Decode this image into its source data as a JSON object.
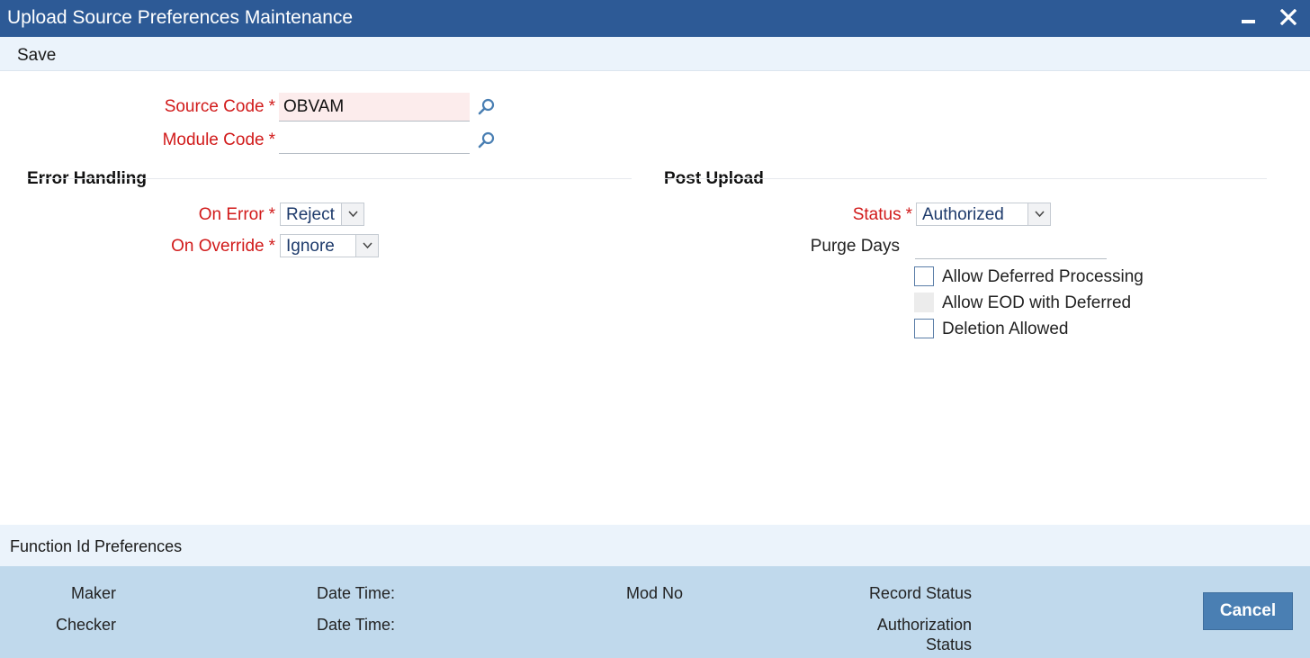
{
  "window": {
    "title": "Upload Source Preferences Maintenance",
    "minimize_icon": "minimize-icon",
    "close_icon": "close-icon"
  },
  "toolbar": {
    "save_label": "Save"
  },
  "fields": {
    "source_code": {
      "label": "Source Code",
      "required_mark": "*",
      "value": "OBVAM"
    },
    "module_code": {
      "label": "Module Code",
      "required_mark": "*",
      "value": ""
    }
  },
  "error_handling": {
    "title": "Error Handling",
    "on_error": {
      "label": "On Error",
      "required_mark": "*",
      "value": "Reject"
    },
    "on_override": {
      "label": "On Override",
      "required_mark": "*",
      "value": "Ignore"
    }
  },
  "post_upload": {
    "title": "Post Upload",
    "status": {
      "label": "Status",
      "required_mark": "*",
      "value": "Authorized"
    },
    "purge_days": {
      "label": "Purge Days",
      "value": ""
    },
    "checkboxes": [
      {
        "label": "Allow Deferred Processing",
        "checked": false,
        "enabled": true
      },
      {
        "label": "Allow EOD with Deferred",
        "checked": false,
        "enabled": false
      },
      {
        "label": "Deletion Allowed",
        "checked": false,
        "enabled": true
      }
    ]
  },
  "subsection": {
    "link_label": "Function Id Preferences"
  },
  "footer": {
    "maker_label": "Maker",
    "checker_label": "Checker",
    "date_time_label_1": "Date Time:",
    "date_time_label_2": "Date Time:",
    "mod_no_label": "Mod No",
    "record_status_label": "Record Status",
    "authorization_label_line1": "Authorization",
    "authorization_label_line2": "Status",
    "cancel_label": "Cancel"
  },
  "colors": {
    "title_bar": "#2d5a96",
    "toolbar_bg": "#ebf3fb",
    "required_label": "#d11a1a",
    "footer_bg": "#c0d9ec",
    "cancel_button": "#4a7fb3",
    "active_field_bg": "#fcecec"
  }
}
